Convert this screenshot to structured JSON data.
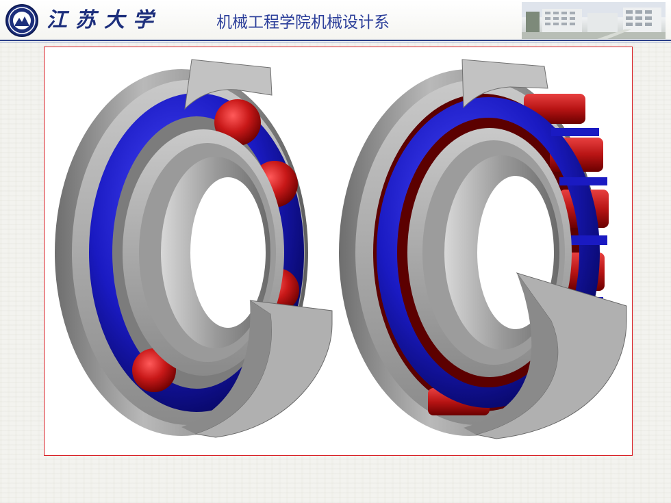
{
  "header": {
    "university_name": "江苏大学",
    "department_name": "机械工程学院机械设计系",
    "logo_icon": "university-seal-icon",
    "photo": "campus-building-photo"
  },
  "figure": {
    "items": [
      {
        "name": "deep-groove-ball-bearing",
        "icon": "ball-bearing-cutaway-icon"
      },
      {
        "name": "cylindrical-roller-bearing",
        "icon": "roller-bearing-cutaway-icon"
      }
    ]
  },
  "colors": {
    "header_blue": "#2a3f88",
    "frame_red": "#d81d23",
    "steel": "#9c9c9c",
    "cage_blue": "#1a1ac2",
    "rolling_element_red": "#c81818"
  }
}
